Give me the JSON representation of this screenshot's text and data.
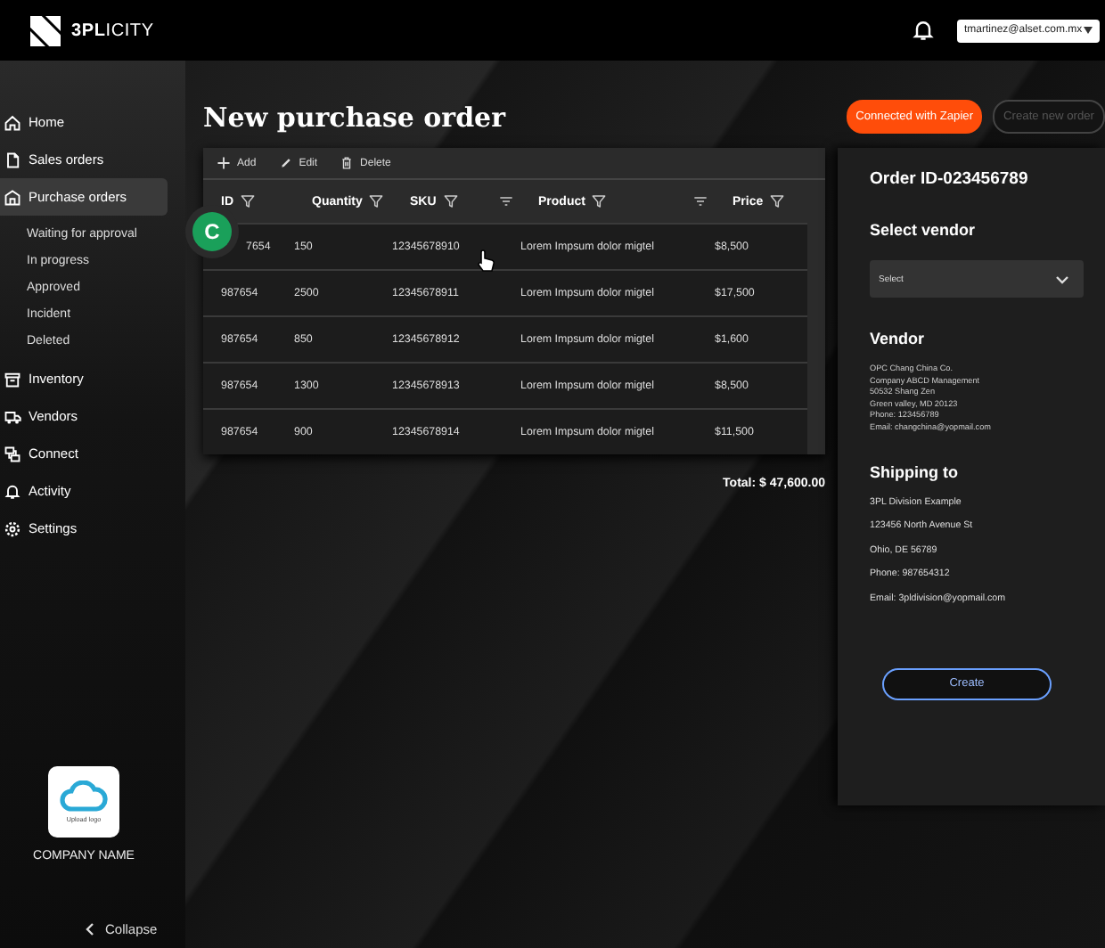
{
  "topbar": {
    "brand": "**3PL**ICITY",
    "user_email": "tmartinez@alset.com.mx"
  },
  "sidebar": {
    "items": [
      {
        "label": "Home",
        "selected": false
      },
      {
        "label": "Sales orders",
        "selected": false
      },
      {
        "label": "Purchase orders",
        "selected": true,
        "children": [
          {
            "label": "Waiting for approval"
          },
          {
            "label": "In progress"
          },
          {
            "label": "Approved"
          },
          {
            "label": "Incident"
          },
          {
            "label": "Deleted"
          }
        ]
      },
      {
        "label": "Inventory",
        "selected": false
      },
      {
        "label": "Vendors",
        "selected": false
      },
      {
        "label": "Connect",
        "selected": false
      },
      {
        "label": "Activity",
        "selected": false
      },
      {
        "label": "Settings",
        "selected": false
      }
    ],
    "logo_caption": "Upload logo",
    "company_name": "COMPANY NAME",
    "collapse": "Collapse"
  },
  "page": {
    "title": "New purchase order",
    "buttons": [
      {
        "label": "Connected with Zapier",
        "kind": "primary"
      },
      {
        "label": "Create new order",
        "kind": "disabled"
      }
    ]
  },
  "avatar": "C",
  "toolbar": [
    "Add",
    "Edit",
    "Delete"
  ],
  "table": {
    "columns": [
      {
        "label": "ID",
        "sort": false
      },
      {
        "label": "Quantity",
        "sort": false
      },
      {
        "label": "SKU",
        "sort": true
      },
      {
        "label": "Product",
        "sort": true
      },
      {
        "label": "Price",
        "sort": false
      }
    ],
    "rows": [
      [
        "7654",
        "150",
        "12345678910",
        "Lorem Impsum dolor migtel",
        "$8,500"
      ],
      [
        "987654",
        "2500",
        "12345678911",
        "Lorem Impsum dolor migtel",
        "$17,500"
      ],
      [
        "987654",
        "850",
        "12345678912",
        "Lorem Impsum dolor migtel",
        "$1,600"
      ],
      [
        "987654",
        "1300",
        "12345678913",
        "Lorem Impsum dolor migtel",
        "$8,500"
      ],
      [
        "987654",
        "900",
        "12345678914",
        "Lorem Impsum dolor migtel",
        "$11,500"
      ]
    ],
    "total": "Total: $ 47,600.00"
  },
  "order_panel": {
    "order_id": "Order ID-023456789",
    "select_vendor": "Select vendor",
    "vendor_select": {
      "placeholder": "Select"
    },
    "vendor_heading": "Vendor",
    "vendor_lines": [
      "OPC Chang China Co.",
      "Company ABCD Management",
      "50532 Shang Zen",
      "Green valley, MD 20123",
      "Phone: 123456789",
      "Email: changchina@yopmail.com"
    ],
    "shipping_heading": "Shipping to",
    "shipping_lines": [
      "3PL Division Example",
      "123456 North Avenue St",
      "Ohio, DE 56789",
      "Phone: 987654312",
      "Email: 3pldivision@yopmail.com"
    ],
    "create_button": "Create"
  }
}
